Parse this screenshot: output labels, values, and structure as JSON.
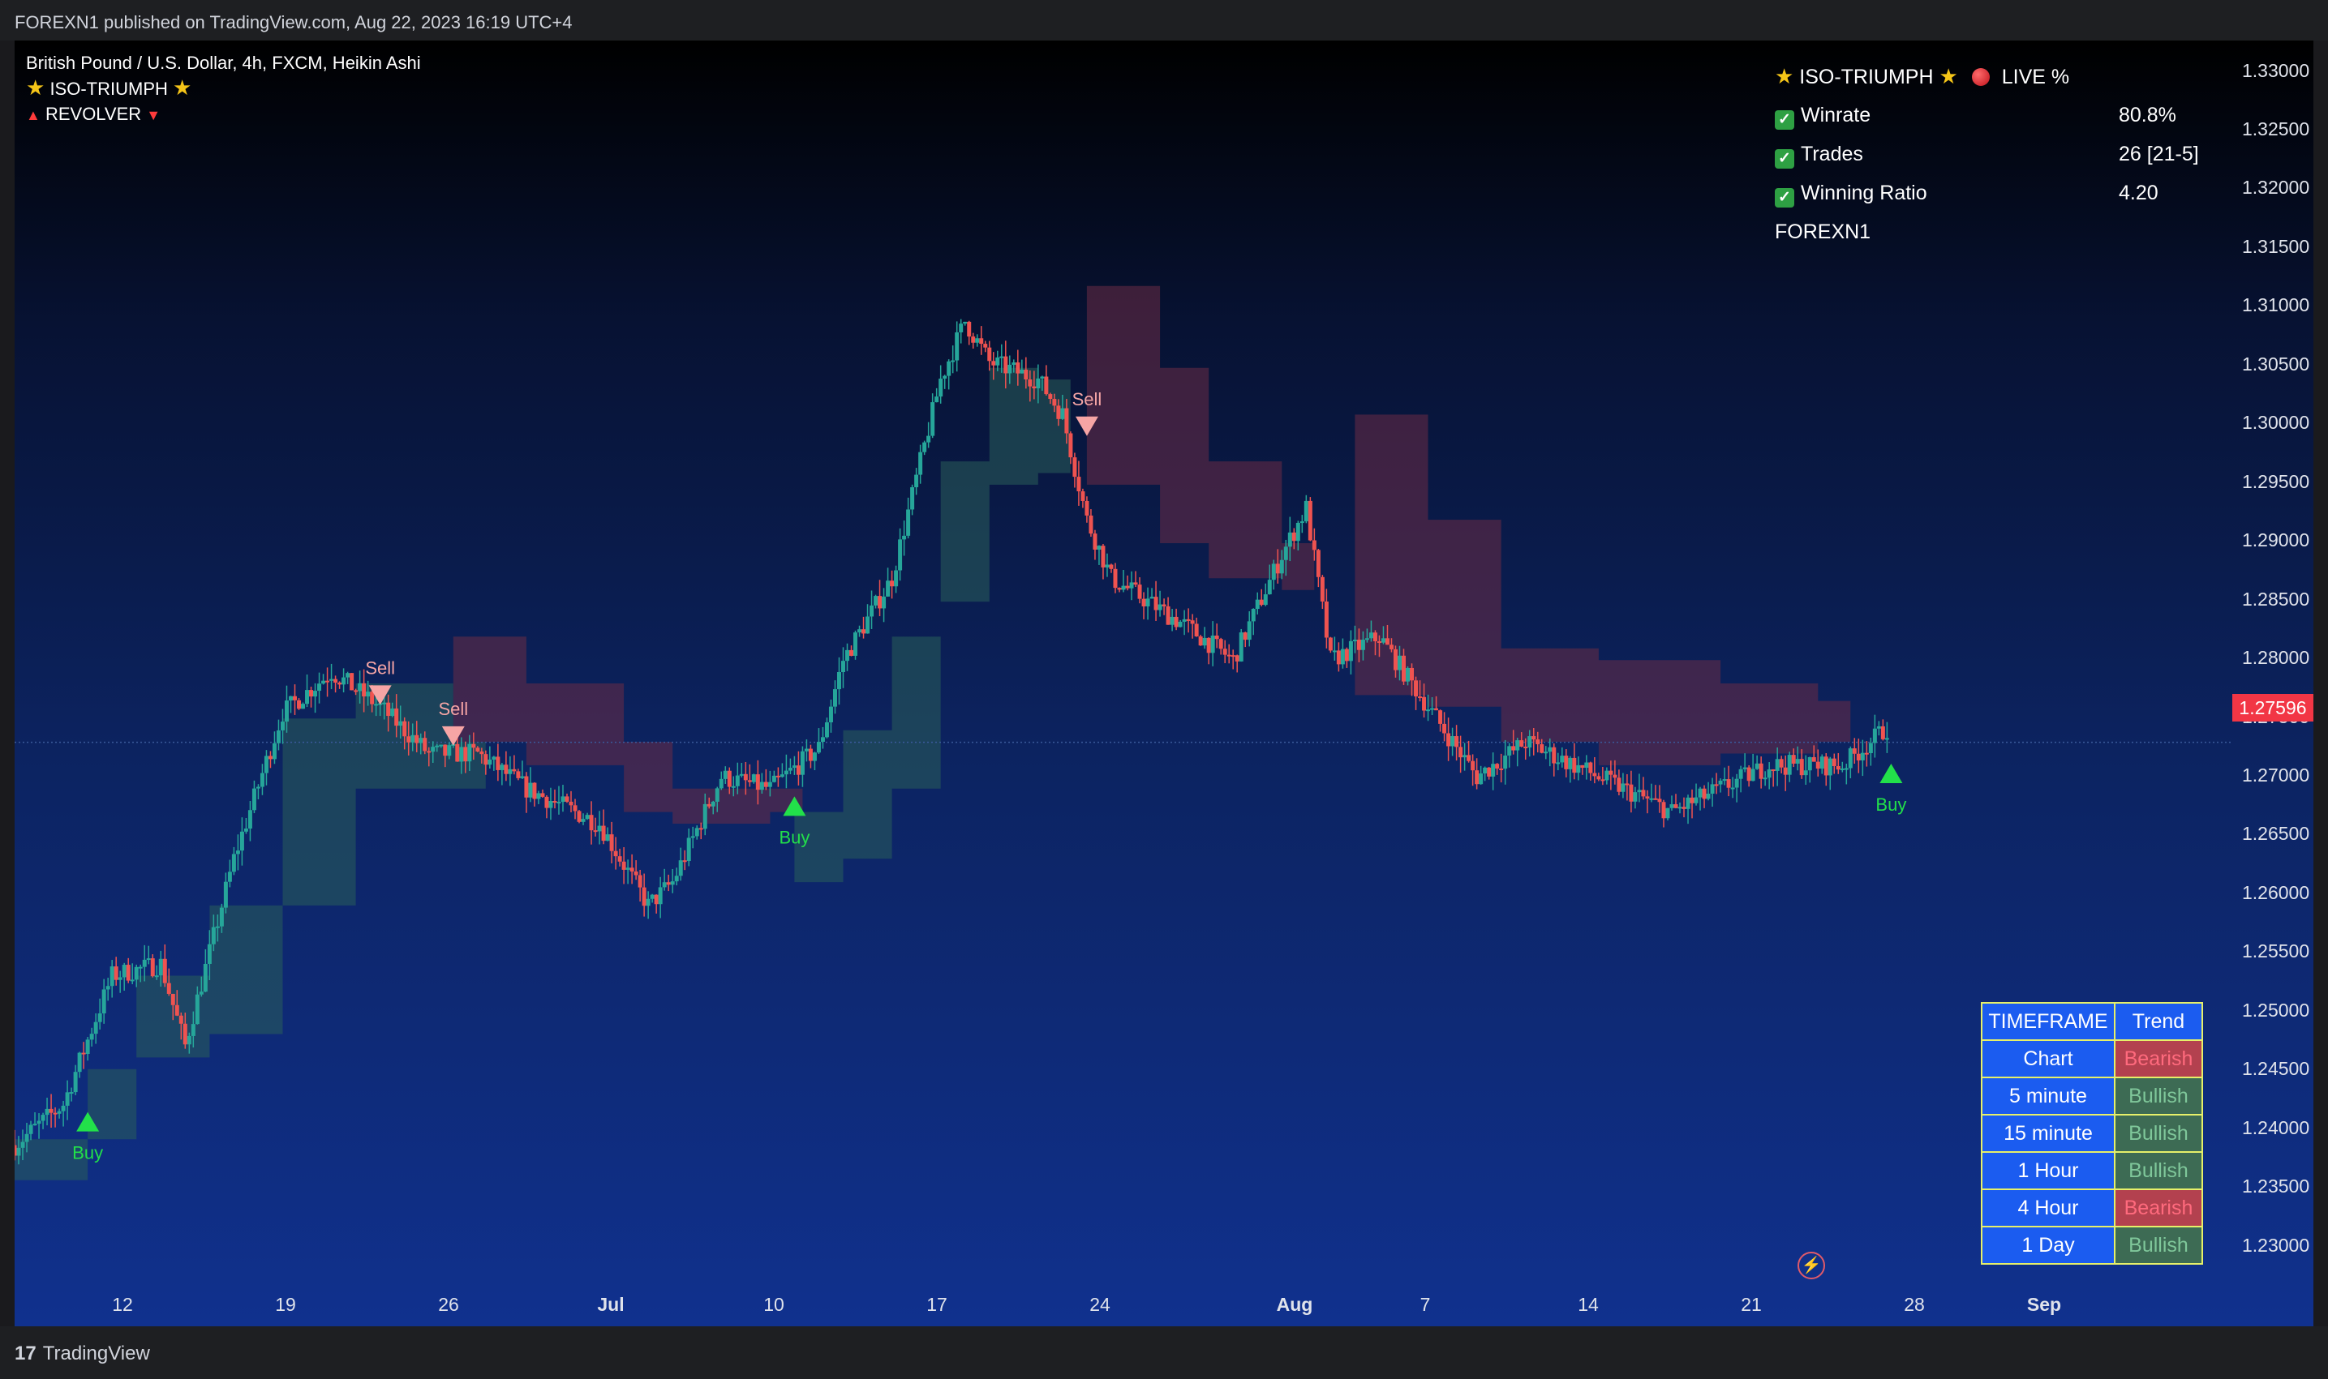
{
  "header": {
    "publish_line": "FOREXN1 published on TradingView.com, Aug 22, 2023 16:19 UTC+4"
  },
  "legend": {
    "symbol_line": "British Pound / U.S. Dollar, 4h, FXCM, Heikin Ashi",
    "indicator1": "ISO-TRIUMPH",
    "indicator2": "REVOLVER"
  },
  "stats_panel": {
    "title": "ISO-TRIUMPH",
    "live_label": "LIVE %",
    "rows": [
      {
        "label": "Winrate",
        "value": "80.8%"
      },
      {
        "label": "Trades",
        "value": "26 [21-5]"
      },
      {
        "label": "Winning Ratio",
        "value": "4.20"
      }
    ],
    "author": "FOREXN1"
  },
  "trend_table": {
    "header_timeframe": "TIMEFRAME",
    "header_trend": "Trend",
    "rows": [
      {
        "timeframe": "Chart",
        "trend": "Bearish"
      },
      {
        "timeframe": "5 minute",
        "trend": "Bullish"
      },
      {
        "timeframe": "15 minute",
        "trend": "Bullish"
      },
      {
        "timeframe": "1 Hour",
        "trend": "Bullish"
      },
      {
        "timeframe": "4 Hour",
        "trend": "Bearish"
      },
      {
        "timeframe": "1 Day",
        "trend": "Bullish"
      }
    ]
  },
  "price_axis": {
    "labels": [
      "1.33000",
      "1.32500",
      "1.32000",
      "1.31500",
      "1.31000",
      "1.30500",
      "1.30000",
      "1.29500",
      "1.29000",
      "1.28500",
      "1.28000",
      "1.27500",
      "1.27000",
      "1.26500",
      "1.26000",
      "1.25500",
      "1.25000",
      "1.24500",
      "1.24000",
      "1.23500",
      "1.23000"
    ],
    "last_price": "1.27596"
  },
  "time_axis": {
    "labels": [
      "12",
      "19",
      "26",
      "Jul",
      "10",
      "17",
      "24",
      "Aug",
      "7",
      "14",
      "21",
      "28",
      "Sep"
    ],
    "bold_labels": [
      "Jul",
      "Aug",
      "Sep"
    ]
  },
  "signals": [
    {
      "type": "buy",
      "label": "Buy",
      "date": "Jun 9",
      "price": 1.2435
    },
    {
      "type": "sell",
      "label": "Sell",
      "date": "Jun 21",
      "price": 1.28
    },
    {
      "type": "sell",
      "label": "Sell",
      "date": "Jun 24",
      "price": 1.2765
    },
    {
      "type": "buy",
      "label": "Buy",
      "date": "Jul 8",
      "price": 1.2705
    },
    {
      "type": "sell",
      "label": "Sell",
      "date": "Jul 20",
      "price": 1.303
    },
    {
      "type": "buy",
      "label": "Buy",
      "date": "Aug 22",
      "price": 1.2733
    }
  ],
  "colors": {
    "bull_candle": "#26a69a",
    "bear_candle": "#ef5350",
    "buy_signal": "#22e04a",
    "sell_signal": "#f6a5a5",
    "last_price_tag": "#f23645",
    "bull_cloud": "#2a5e5a",
    "bear_cloud": "#6b2c45"
  },
  "icons": {
    "star": "star-icon",
    "live_dot": "red-circle-icon",
    "check": "check-icon",
    "bolt": "lightning-icon",
    "logo": "tradingview-logo"
  },
  "footer": {
    "brand": "TradingView",
    "logo_mark": "17"
  },
  "chart_data": {
    "type": "candlestick",
    "title": "British Pound / U.S. Dollar, 4h, FXCM, Heikin Ashi",
    "y_range": [
      1.226,
      1.336
    ],
    "x_range": [
      "Jun 6",
      "Sep 5"
    ],
    "grid": false,
    "anchors": [
      [
        "Jun 6",
        1.2415
      ],
      [
        "Jun 8",
        1.245
      ],
      [
        "Jun 10",
        1.256
      ],
      [
        "Jun 12",
        1.257
      ],
      [
        "Jun 13",
        1.25
      ],
      [
        "Jun 15",
        1.266
      ],
      [
        "Jun 17",
        1.2785
      ],
      [
        "Jun 19",
        1.282
      ],
      [
        "Jun 21",
        1.279
      ],
      [
        "Jun 23",
        1.275
      ],
      [
        "Jun 25",
        1.275
      ],
      [
        "Jun 27",
        1.272
      ],
      [
        "Jun 30",
        1.269
      ],
      [
        "Jul 2",
        1.262
      ],
      [
        "Jul 3",
        1.264
      ],
      [
        "Jul 5",
        1.273
      ],
      [
        "Jul 7",
        1.272
      ],
      [
        "Jul 9",
        1.2755
      ],
      [
        "Jul 10",
        1.283
      ],
      [
        "Jul 12",
        1.29
      ],
      [
        "Jul 14",
        1.307
      ],
      [
        "Jul 15",
        1.312
      ],
      [
        "Jul 16",
        1.3085
      ],
      [
        "Jul 18",
        1.307
      ],
      [
        "Jul 19",
        1.304
      ],
      [
        "Jul 20",
        1.295
      ],
      [
        "Jul 21",
        1.29
      ],
      [
        "Jul 24",
        1.286
      ],
      [
        "Jul 26",
        1.283
      ],
      [
        "Jul 28",
        1.292
      ],
      [
        "Jul 29",
        1.296
      ],
      [
        "Jul 30",
        1.283
      ],
      [
        "Aug 1",
        1.285
      ],
      [
        "Aug 3",
        1.279
      ],
      [
        "Aug 5",
        1.273
      ],
      [
        "Aug 7",
        1.276
      ],
      [
        "Aug 9",
        1.274
      ],
      [
        "Aug 11",
        1.272
      ],
      [
        "Aug 13",
        1.27
      ],
      [
        "Aug 15",
        1.272
      ],
      [
        "Aug 17",
        1.274
      ],
      [
        "Aug 20",
        1.274
      ],
      [
        "Aug 22",
        1.2775
      ]
    ],
    "bull_cloud": [
      [
        "Jun 6",
        1.2385,
        1.242
      ],
      [
        "Jun 9",
        1.242,
        1.248
      ],
      [
        "Jun 11",
        1.249,
        1.256
      ],
      [
        "Jun 14",
        1.251,
        1.262
      ],
      [
        "Jun 17",
        1.262,
        1.278
      ],
      [
        "Jun 20",
        1.272,
        1.281
      ],
      [
        "Jun 24",
        1.272,
        1.276
      ]
    ],
    "bear_cloud": [
      [
        "Jun 24",
        1.276,
        1.285
      ],
      [
        "Jun 27",
        1.274,
        1.281
      ],
      [
        "Jul 1",
        1.27,
        1.276
      ],
      [
        "Jul 3",
        1.269,
        1.272
      ],
      [
        "Jul 7",
        1.27,
        1.272
      ]
    ]
  }
}
